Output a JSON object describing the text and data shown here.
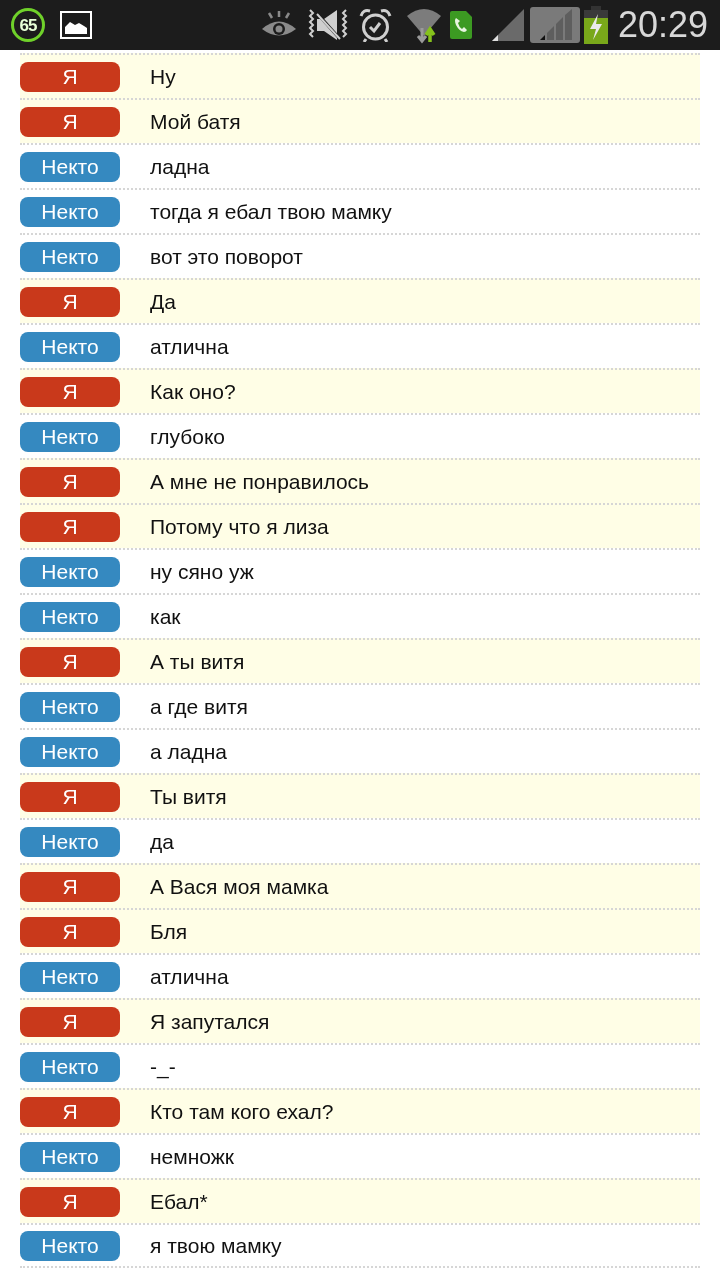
{
  "status_bar": {
    "counter": "65",
    "time": "20:29"
  },
  "messages": [
    {
      "kind": "me",
      "sender": "Я",
      "text": "Ну"
    },
    {
      "kind": "me",
      "sender": "Я",
      "text": "Мой батя"
    },
    {
      "kind": "stranger",
      "sender": "Некто",
      "text": "ладна"
    },
    {
      "kind": "stranger",
      "sender": "Некто",
      "text": "тогда я ебал твою мамку"
    },
    {
      "kind": "stranger",
      "sender": "Некто",
      "text": "вот это поворот"
    },
    {
      "kind": "me",
      "sender": "Я",
      "text": "Да"
    },
    {
      "kind": "stranger",
      "sender": "Некто",
      "text": "атлична"
    },
    {
      "kind": "me",
      "sender": "Я",
      "text": "Как оно?"
    },
    {
      "kind": "stranger",
      "sender": "Некто",
      "text": "глубоко"
    },
    {
      "kind": "me",
      "sender": "Я",
      "text": "А мне не понравилось"
    },
    {
      "kind": "me",
      "sender": "Я",
      "text": "Потому что я лиза"
    },
    {
      "kind": "stranger",
      "sender": "Некто",
      "text": "ну сяно уж"
    },
    {
      "kind": "stranger",
      "sender": "Некто",
      "text": "как"
    },
    {
      "kind": "me",
      "sender": "Я",
      "text": "А ты витя"
    },
    {
      "kind": "stranger",
      "sender": "Некто",
      "text": "а где витя"
    },
    {
      "kind": "stranger",
      "sender": "Некто",
      "text": "а ладна"
    },
    {
      "kind": "me",
      "sender": "Я",
      "text": "Ты витя"
    },
    {
      "kind": "stranger",
      "sender": "Некто",
      "text": "да"
    },
    {
      "kind": "me",
      "sender": "Я",
      "text": "А Вася моя мамка"
    },
    {
      "kind": "me",
      "sender": "Я",
      "text": "Бля"
    },
    {
      "kind": "stranger",
      "sender": "Некто",
      "text": "атлична"
    },
    {
      "kind": "me",
      "sender": "Я",
      "text": "Я запутался"
    },
    {
      "kind": "stranger",
      "sender": "Некто",
      "text": "-_-"
    },
    {
      "kind": "me",
      "sender": "Я",
      "text": "Кто там кого ехал?"
    },
    {
      "kind": "stranger",
      "sender": "Некто",
      "text": "немножк"
    },
    {
      "kind": "me",
      "sender": "Я",
      "text": "Ебал*"
    },
    {
      "kind": "stranger",
      "sender": "Некто",
      "text": "я твою мамку"
    }
  ]
}
